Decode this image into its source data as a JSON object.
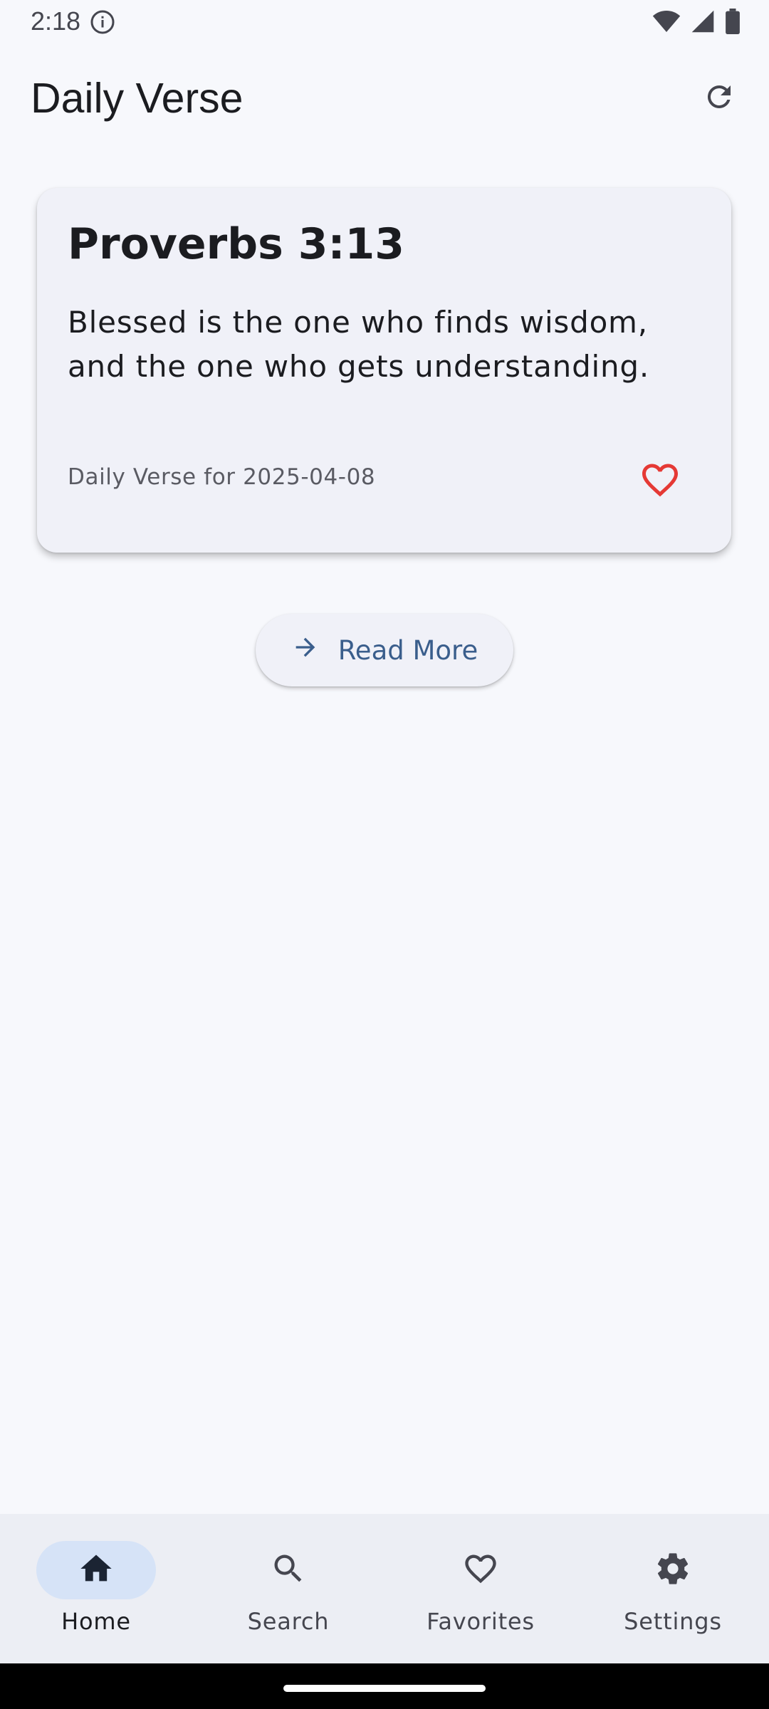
{
  "status_bar": {
    "time": "2:18",
    "icons": [
      "info-icon",
      "wifi-icon",
      "signal-icon",
      "battery-icon"
    ]
  },
  "app_bar": {
    "title": "Daily Verse",
    "refresh_icon": "refresh-icon"
  },
  "verse_card": {
    "reference": "Proverbs 3:13",
    "text": "Blessed is the one who finds wisdom, and the one who gets understanding.",
    "date_label": "Daily Verse for 2025-04-08",
    "favorite_icon": "heart-outline-icon"
  },
  "read_more": {
    "label": "Read More",
    "icon": "arrow-right-icon"
  },
  "bottom_nav": {
    "items": [
      {
        "label": "Home",
        "icon": "home-icon",
        "active": true
      },
      {
        "label": "Search",
        "icon": "search-icon",
        "active": false
      },
      {
        "label": "Favorites",
        "icon": "heart-outline-icon",
        "active": false
      },
      {
        "label": "Settings",
        "icon": "gear-icon",
        "active": false
      }
    ]
  },
  "colors": {
    "background": "#f7f8fc",
    "card": "#f0f1f8",
    "accent": "#3a5e8c",
    "favorite": "#e53935",
    "nav_active_pill": "#d6e3f7",
    "nav_bar": "#eceef4"
  }
}
